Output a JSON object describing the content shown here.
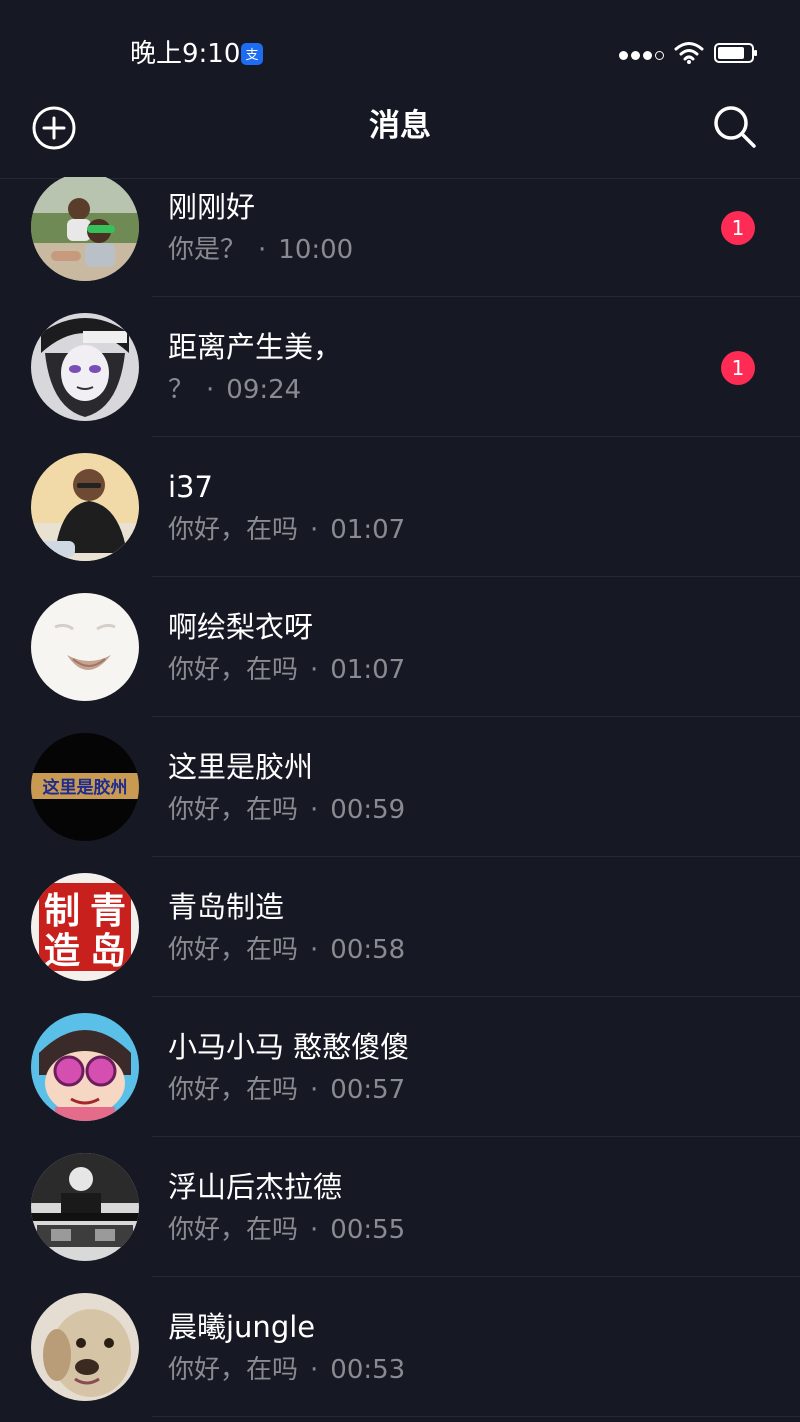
{
  "status_bar": {
    "time": "晚上9:10",
    "app_badge_icon": "alipay-icon",
    "signal_icon": "signal-dots-icon",
    "wifi_icon": "wifi-icon",
    "battery_icon": "battery-icon"
  },
  "header": {
    "title": "消息",
    "add_icon": "add-circle-icon",
    "search_icon": "search-icon"
  },
  "colors": {
    "background": "#161823",
    "unread_badge": "#fe2c55",
    "secondary_text": "#8a8b91"
  },
  "conversations": [
    {
      "name": "刚刚好",
      "preview": "你是？",
      "separator": "·",
      "time": "10:00",
      "unread": "1"
    },
    {
      "name": "距离产生美，",
      "preview": "？",
      "separator": "·",
      "time": "09:24",
      "unread": "1"
    },
    {
      "name": "i37",
      "preview": "你好，在吗",
      "separator": "·",
      "time": "01:07"
    },
    {
      "name": "啊绘梨衣呀",
      "preview": "你好，在吗",
      "separator": "·",
      "time": "01:07"
    },
    {
      "name": "这里是胶州",
      "preview": "你好，在吗",
      "separator": "·",
      "time": "00:59",
      "avatar_text": "这里是胶州"
    },
    {
      "name": "青岛制造",
      "preview": "你好，在吗",
      "separator": "·",
      "time": "00:58",
      "avatar_chars": [
        "制",
        "青",
        "造",
        "岛"
      ]
    },
    {
      "name": "小马小马 憨憨傻傻",
      "preview": "你好，在吗",
      "separator": "·",
      "time": "00:57"
    },
    {
      "name": "浮山后杰拉德",
      "preview": "你好，在吗",
      "separator": "·",
      "time": "00:55"
    },
    {
      "name": "晨曦jungle",
      "preview": "你好，在吗",
      "separator": "·",
      "time": "00:53"
    }
  ]
}
